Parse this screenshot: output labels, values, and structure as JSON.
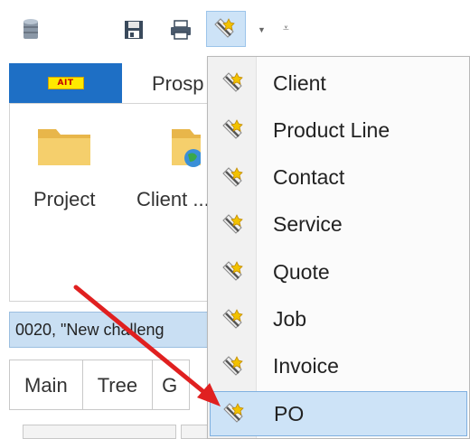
{
  "ribbon": {
    "tab_prosp": "Prosp",
    "buttons": [
      {
        "label": "Project"
      },
      {
        "label": "Client ..."
      }
    ]
  },
  "desc_bar": {
    "text": "0020, \"New challeng"
  },
  "lower_tabs": [
    "Main",
    "Tree",
    "G"
  ],
  "menu": {
    "items": [
      {
        "label": "Client"
      },
      {
        "label": "Product Line"
      },
      {
        "label": "Contact"
      },
      {
        "label": "Service"
      },
      {
        "label": "Quote"
      },
      {
        "label": "Job"
      },
      {
        "label": "Invoice"
      },
      {
        "label": "PO"
      }
    ],
    "highlighted": "PO"
  },
  "colors": {
    "file_tab": "#1e6fc5",
    "highlight": "#cde3f7",
    "arrow": "#e02020",
    "logo_bg": "#ffe900"
  }
}
